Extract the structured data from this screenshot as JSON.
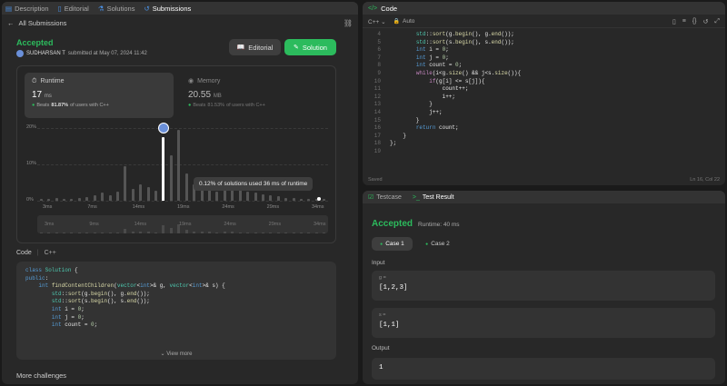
{
  "left_tabs": [
    {
      "label": "Description",
      "icon": "description-icon",
      "active": false
    },
    {
      "label": "Editorial",
      "icon": "book-icon",
      "active": false
    },
    {
      "label": "Solutions",
      "icon": "flask-icon",
      "active": false
    },
    {
      "label": "Submissions",
      "icon": "history-icon",
      "active": true
    }
  ],
  "back_link": "All Submissions",
  "status": {
    "label": "Accepted",
    "user": "SUDHARSAN T",
    "submitted_text": "submitted at May 07, 2024 11:42",
    "accent": "#2cbb5d"
  },
  "buttons": {
    "editorial": "Editorial",
    "solution": "Solution"
  },
  "runtime": {
    "label": "Runtime",
    "value": "17",
    "unit": "ms",
    "beats_prefix": "Beats",
    "beats_pct": "81.87%",
    "beats_suffix": "of users with C++"
  },
  "memory": {
    "label": "Memory",
    "value": "20.55",
    "unit": "MB",
    "beats_prefix": "Beats",
    "beats_pct": "81.53%",
    "beats_suffix": "of users with C++"
  },
  "chart_data": {
    "type": "bar",
    "y_ticks": [
      "20%",
      "10%",
      "0%"
    ],
    "x_ticks": [
      "3ms",
      "7ms",
      "14ms",
      "19ms",
      "24ms",
      "29ms",
      "34ms"
    ],
    "tooltip": "0.12% of solutions used 36 ms of runtime",
    "ylim": [
      0,
      20
    ],
    "values": [
      0.4,
      0.6,
      0.8,
      0.5,
      0.6,
      0.7,
      1.0,
      1.5,
      2.2,
      1.6,
      2.6,
      9.4,
      3.2,
      4.6,
      3.8,
      2.8,
      17.5,
      12.5,
      19.5,
      7.5,
      4.4,
      3.6,
      4.8,
      2.6,
      3.4,
      3.6,
      3.0,
      2.6,
      2.2,
      1.8,
      1.4,
      1.2,
      0.8,
      0.7,
      0.6,
      0.5,
      0.4,
      0.4
    ],
    "highlight_index": 16,
    "mini_ticks": [
      "3ms",
      "9ms",
      "14ms",
      "19ms",
      "24ms",
      "29ms",
      "34ms"
    ]
  },
  "code_section": {
    "label": "Code",
    "lang": "C++",
    "view_more": "View more"
  },
  "left_code": [
    "class Solution {",
    "public:",
    "    int findContentChildren(vector<int>& g, vector<int>& s) {",
    "        std::sort(g.begin(), g.end());",
    "        std::sort(s.begin(), s.end());",
    "        int i = 0;",
    "        int j = 0;",
    "        int count = 0;"
  ],
  "more_challenges": "More challenges",
  "editor": {
    "title": "Code",
    "lang": "C++",
    "mode": "Auto",
    "saved": "Saved",
    "cursor": "Ln 16, Col 22",
    "line_numbers": [
      "4",
      "5",
      "6",
      "7",
      "8",
      "9",
      "10",
      "11",
      "12",
      "13",
      "14",
      "15",
      "16",
      "17",
      "18",
      "19"
    ],
    "lines": [
      "        std::sort(g.begin(), g.end());",
      "        std::sort(s.begin(), s.end());",
      "        int i = 0;",
      "        int j = 0;",
      "        int count = 0;",
      "        while(i<g.size() && j<s.size()){",
      "            if(g[i] <= s[j]){",
      "                count++;",
      "                i++;",
      "            }",
      "            j++;",
      "        }",
      "        return count;",
      "    }",
      "};",
      ""
    ]
  },
  "result_panel": {
    "tab_testcase": "Testcase",
    "tab_result": "Test Result",
    "status": "Accepted",
    "runtime": "Runtime: 40 ms",
    "cases": [
      "Case 1",
      "Case 2"
    ],
    "input_label": "Input",
    "inputs": [
      {
        "name": "g =",
        "value": "[1,2,3]"
      },
      {
        "name": "s =",
        "value": "[1,1]"
      }
    ],
    "output_label": "Output",
    "output_value": "1"
  }
}
